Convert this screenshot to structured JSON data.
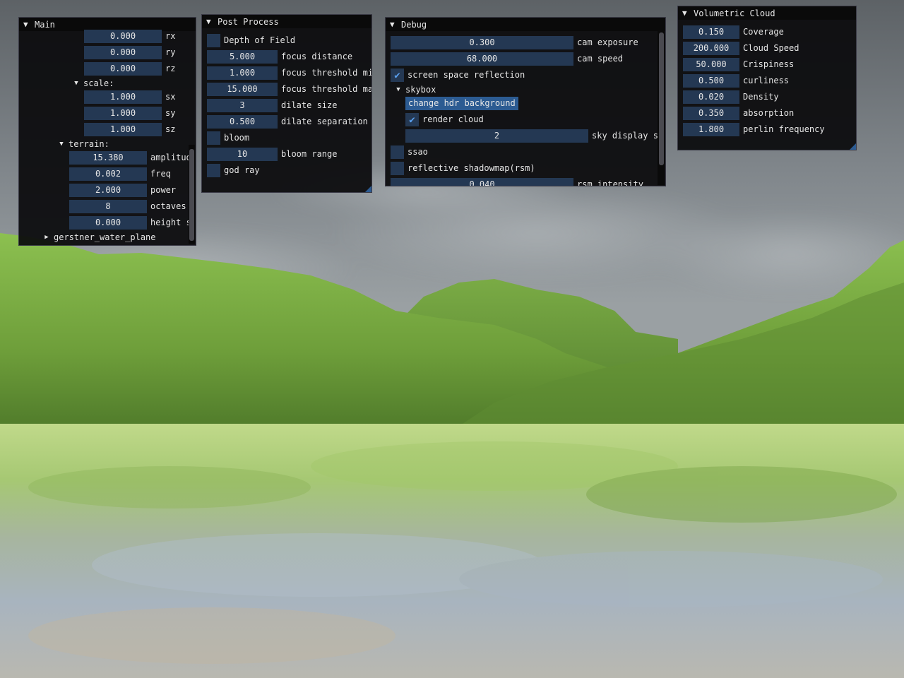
{
  "main": {
    "title": "Main",
    "rx": {
      "value": "0.000",
      "label": "rx"
    },
    "ry": {
      "value": "0.000",
      "label": "ry"
    },
    "rz": {
      "value": "0.000",
      "label": "rz"
    },
    "scale_label": "scale:",
    "sx": {
      "value": "1.000",
      "label": "sx"
    },
    "sy": {
      "value": "1.000",
      "label": "sy"
    },
    "sz": {
      "value": "1.000",
      "label": "sz"
    },
    "terrain_label": "terrain:",
    "amplitude": {
      "value": "15.380",
      "label": "amplitud"
    },
    "freq": {
      "value": "0.002",
      "label": "freq"
    },
    "power": {
      "value": "2.000",
      "label": "power"
    },
    "octaves": {
      "value": "8",
      "label": "octaves"
    },
    "height": {
      "value": "0.000",
      "label": "height s"
    },
    "gerstner_label": "gerstner_water_plane"
  },
  "post": {
    "title": "Post Process",
    "dof_label": "Depth of Field",
    "focus_distance": {
      "value": "5.000",
      "label": "focus distance"
    },
    "focus_min": {
      "value": "1.000",
      "label": "focus threshold mi"
    },
    "focus_max": {
      "value": "15.000",
      "label": "focus threshold ma"
    },
    "dilate_size": {
      "value": "3",
      "label": "dilate size"
    },
    "dilate_sep": {
      "value": "0.500",
      "label": "dilate separation"
    },
    "bloom_label": "bloom",
    "bloom_range": {
      "value": "10",
      "label": "bloom range"
    },
    "god_ray_label": "god ray"
  },
  "debug": {
    "title": "Debug",
    "cam_exposure": {
      "value": "0.300",
      "label": "cam exposure"
    },
    "cam_speed": {
      "value": "68.000",
      "label": "cam speed"
    },
    "ssr_label": "screen space reflection",
    "skybox_label": "skybox",
    "hdr_button": "change hdr background",
    "render_cloud_label": "render cloud",
    "sky_display": {
      "value": "2",
      "label": "sky display s"
    },
    "ssao_label": "ssao",
    "rsm_label": "reflective shadowmap(rsm)",
    "rsm_intensity": {
      "value": "0.040",
      "label": "rsm intensity"
    }
  },
  "cloud": {
    "title": "Volumetric Cloud",
    "coverage": {
      "value": "0.150",
      "label": "Coverage"
    },
    "cloud_speed": {
      "value": "200.000",
      "label": "Cloud Speed"
    },
    "crispiness": {
      "value": "50.000",
      "label": "Crispiness"
    },
    "curliness": {
      "value": "0.500",
      "label": "curliness"
    },
    "density": {
      "value": "0.020",
      "label": "Density"
    },
    "absorption": {
      "value": "0.350",
      "label": "absorption"
    },
    "perlin": {
      "value": "1.800",
      "label": "perlin frequency"
    }
  },
  "icons": {
    "collapse": "triangle-down-icon",
    "expand": "triangle-right-icon",
    "check": "checkmark-icon"
  },
  "colors": {
    "frame_bg": "#243853",
    "button": "#2c5b92",
    "check": "#5aa0f0",
    "panel": "#0c0c0e"
  }
}
